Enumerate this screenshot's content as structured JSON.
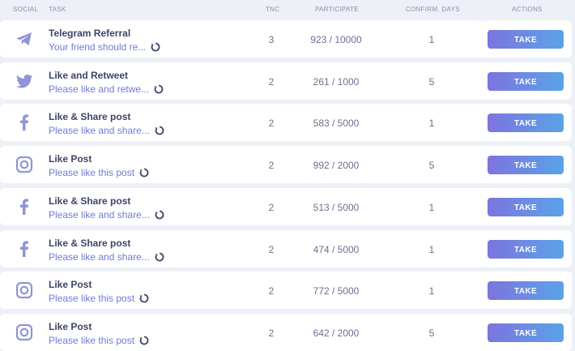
{
  "header": {
    "social": "SOCIAL",
    "task": "TASK",
    "tnc": "TNC",
    "participate": "PARTICIPATE",
    "confirm_days": "CONFIRM. DAYS",
    "actions": "ACTIONS"
  },
  "colors": {
    "icon": "#8f95d6",
    "accent_text": "#6f7ad6",
    "button_start": "#7d74df",
    "button_end": "#5aa3e8"
  },
  "rows": [
    {
      "icon": "telegram-icon",
      "title": "Telegram Referral",
      "desc": "Your friend should re...",
      "tnc": "3",
      "participate": "923 / 10000",
      "confirm_days": "1",
      "action": "TAKE"
    },
    {
      "icon": "twitter-icon",
      "title": "Like and Retweet",
      "desc": "Please like and retwe...",
      "tnc": "2",
      "participate": "261 / 1000",
      "confirm_days": "5",
      "action": "TAKE"
    },
    {
      "icon": "facebook-icon",
      "title": "Like & Share post",
      "desc": "Please like and share...",
      "tnc": "2",
      "participate": "583 / 5000",
      "confirm_days": "1",
      "action": "TAKE"
    },
    {
      "icon": "instagram-icon",
      "title": "Like Post",
      "desc": "Please like this post",
      "tnc": "2",
      "participate": "992 / 2000",
      "confirm_days": "5",
      "action": "TAKE"
    },
    {
      "icon": "facebook-icon",
      "title": "Like & Share post",
      "desc": "Please like and share...",
      "tnc": "2",
      "participate": "513 / 5000",
      "confirm_days": "1",
      "action": "TAKE"
    },
    {
      "icon": "facebook-icon",
      "title": "Like & Share post",
      "desc": "Please like and share...",
      "tnc": "2",
      "participate": "474 / 5000",
      "confirm_days": "1",
      "action": "TAKE"
    },
    {
      "icon": "instagram-icon",
      "title": "Like Post",
      "desc": "Please like this post",
      "tnc": "2",
      "participate": "772 / 5000",
      "confirm_days": "1",
      "action": "TAKE"
    },
    {
      "icon": "instagram-icon",
      "title": "Like Post",
      "desc": "Please like this post",
      "tnc": "2",
      "participate": "642 / 2000",
      "confirm_days": "5",
      "action": "TAKE"
    }
  ]
}
